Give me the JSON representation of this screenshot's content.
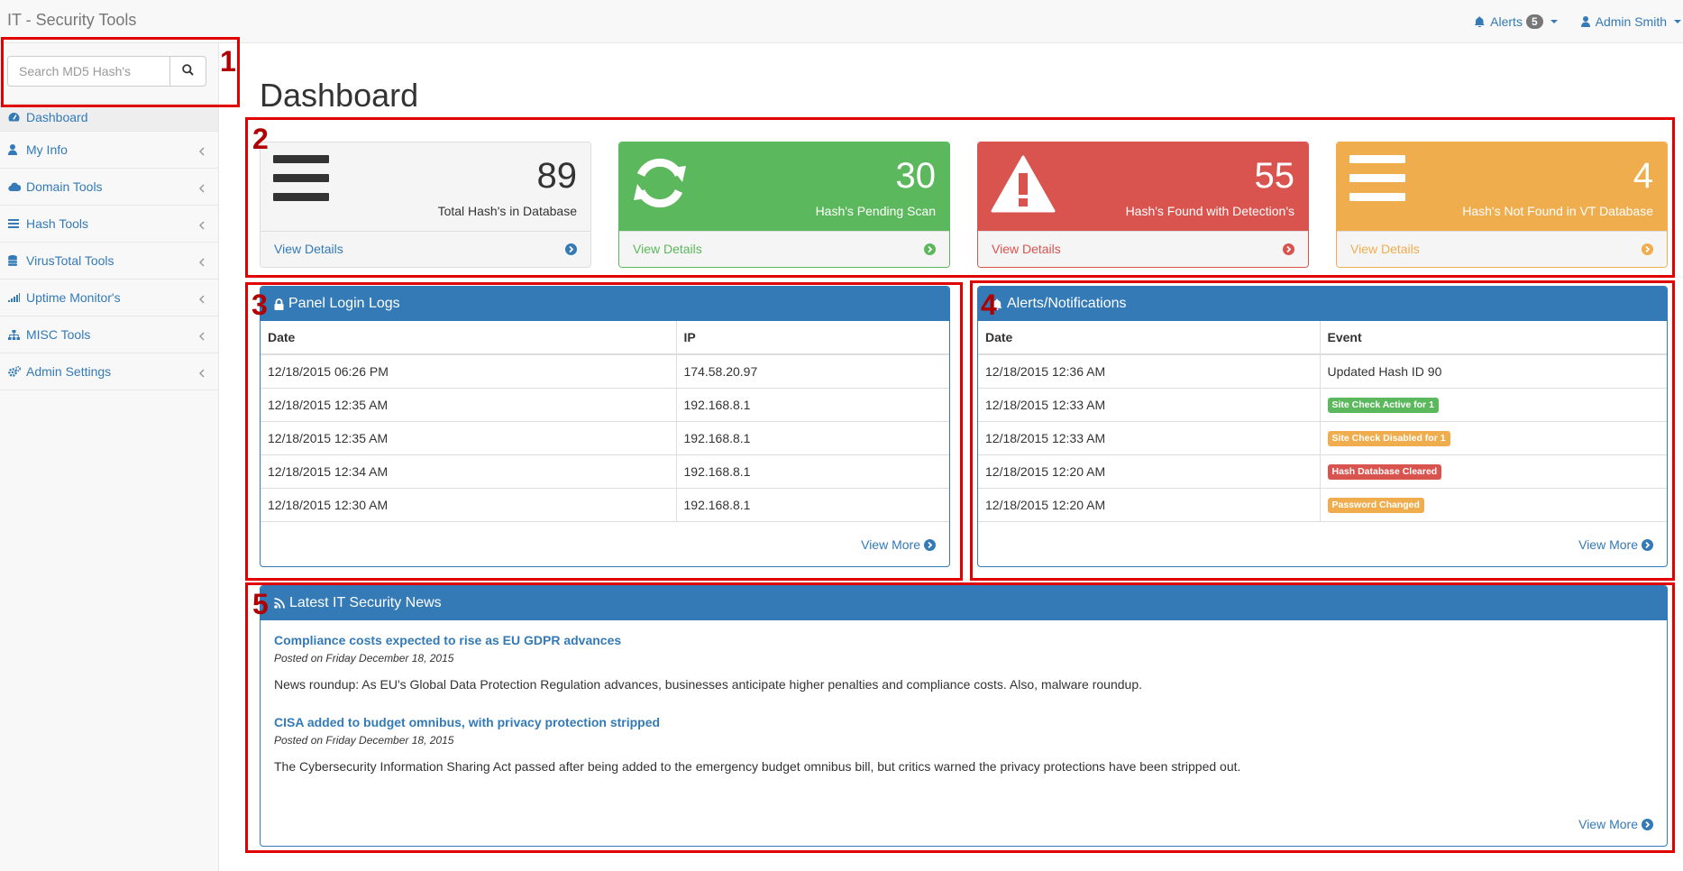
{
  "app": {
    "title": "IT - Security Tools"
  },
  "navbar": {
    "alerts_label": "Alerts",
    "alerts_count": "5",
    "user_label": "Admin Smith"
  },
  "sidebar": {
    "search_placeholder": "Search MD5 Hash's",
    "items": [
      {
        "label": "Dashboard",
        "icon": "dashboard-icon"
      },
      {
        "label": "My Info",
        "icon": "user-icon"
      },
      {
        "label": "Domain Tools",
        "icon": "cloud-icon"
      },
      {
        "label": "Hash Tools",
        "icon": "bars-icon"
      },
      {
        "label": "VirusTotal Tools",
        "icon": "database-icon"
      },
      {
        "label": "Uptime Monitor's",
        "icon": "signal-icon"
      },
      {
        "label": "MISC Tools",
        "icon": "sitemap-icon"
      },
      {
        "label": "Admin Settings",
        "icon": "cogs-icon"
      }
    ]
  },
  "page": {
    "title": "Dashboard"
  },
  "stats": [
    {
      "value": "89",
      "label": "Total Hash's in Database",
      "link": "View Details",
      "color": "#f5f5f5",
      "icon": "bars-icon"
    },
    {
      "value": "30",
      "label": "Hash's Pending Scan",
      "link": "View Details",
      "color": "#5cb85c",
      "icon": "refresh-icon"
    },
    {
      "value": "55",
      "label": "Hash's Found with Detection's",
      "link": "View Details",
      "color": "#d9534f",
      "icon": "warning-icon"
    },
    {
      "value": "4",
      "label": "Hash's Not Found in VT Database",
      "link": "View Details",
      "color": "#f0ad4e",
      "icon": "bars-icon"
    }
  ],
  "login_logs": {
    "title": "Panel Login Logs",
    "columns": [
      "Date",
      "IP"
    ],
    "rows": [
      [
        "12/18/2015 06:26 PM",
        "174.58.20.97"
      ],
      [
        "12/18/2015 12:35 AM",
        "192.168.8.1"
      ],
      [
        "12/18/2015 12:35 AM",
        "192.168.8.1"
      ],
      [
        "12/18/2015 12:34 AM",
        "192.168.8.1"
      ],
      [
        "12/18/2015 12:30 AM",
        "192.168.8.1"
      ]
    ],
    "view_more": "View More"
  },
  "alerts": {
    "title": "Alerts/Notifications",
    "columns": [
      "Date",
      "Event"
    ],
    "rows": [
      {
        "date": "12/18/2015 12:36 AM",
        "event": "Updated Hash ID 90"
      },
      {
        "date": "12/18/2015 12:33 AM",
        "event": "Site Check Active for 1"
      },
      {
        "date": "12/18/2015 12:33 AM",
        "event": "Site Check Disabled for 1"
      },
      {
        "date": "12/18/2015 12:20 AM",
        "event": "Hash Database Cleared"
      },
      {
        "date": "12/18/2015 12:20 AM",
        "event": "Password Changed"
      }
    ],
    "view_more": "View More"
  },
  "news": {
    "title": "Latest IT Security News",
    "articles": [
      {
        "title": "Compliance costs expected to rise as EU GDPR advances",
        "date": "Posted on Friday December 18, 2015",
        "summary": "News roundup: As EU's Global Data Protection Regulation advances, businesses anticipate higher penalties and compliance costs. Also, malware roundup."
      },
      {
        "title": "CISA added to budget omnibus, with privacy protection stripped",
        "date": "Posted on Friday December 18, 2015",
        "summary": "The Cybersecurity Information Sharing Act passed after being added to the emergency budget omnibus bill, but critics warned the privacy protections have been stripped out."
      }
    ],
    "view_more": "View More"
  },
  "annotations": [
    "1",
    "2",
    "3",
    "4",
    "5"
  ],
  "colors": {
    "primary": "#337ab7",
    "success": "#5cb85c",
    "danger": "#d9534f",
    "warning": "#f0ad4e",
    "annotation": "#e00000"
  }
}
